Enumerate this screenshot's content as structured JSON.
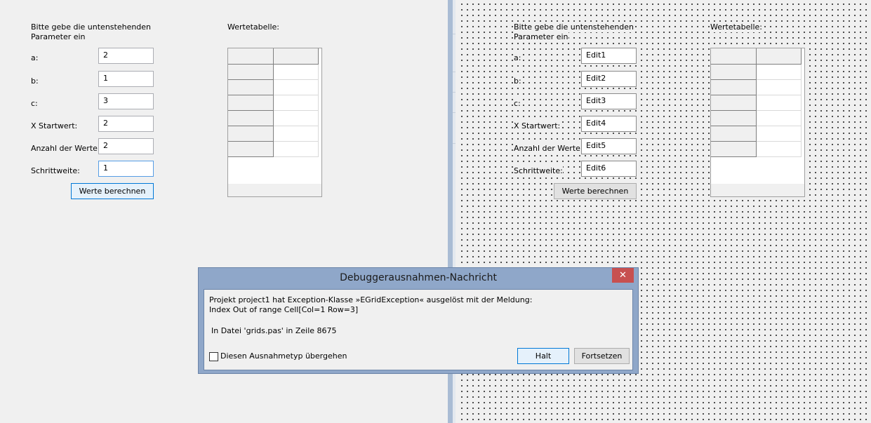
{
  "runtime_form": {
    "intro": "Bitte gebe die untenstehenden",
    "intro2": "Parameter ein",
    "table_label": "Wertetabelle:",
    "labels": [
      "a:",
      "b:",
      "c:",
      "X Startwert:",
      "Anzahl der Werte:",
      "Schrittweite:"
    ],
    "values": [
      "2",
      "1",
      "3",
      "2",
      "2",
      "1"
    ],
    "button": "Werte berechnen"
  },
  "designer_form": {
    "intro": "Bitte gebe die untenstehenden",
    "intro2": "Parameter ein",
    "table_label": "Wertetabelle:",
    "labels": [
      "a:",
      "b:",
      "c:",
      "X Startwert:",
      "Anzahl der Werte:",
      "Schrittweite:"
    ],
    "edits": [
      "Edit1",
      "Edit2",
      "Edit3",
      "Edit4",
      "Edit5",
      "Edit6"
    ],
    "button": "Werte berechnen"
  },
  "dialog": {
    "title": "Debuggerausnahmen-Nachricht",
    "close": "✕",
    "line1": "Projekt project1 hat Exception-Klasse »EGridException« ausgelöst mit der Meldung:",
    "line2": "Index Out of range Cell[Col=1 Row=3]",
    "line3": "In Datei 'grids.pas' in Zeile 8675",
    "checkbox_label": "Diesen Ausnahmetyp übergehen",
    "halt": "Halt",
    "continue": "Fortsetzen"
  },
  "colors": {
    "dialog_frame": "#8fa7c9",
    "close_button": "#c75050",
    "focus_border": "#569de5"
  }
}
